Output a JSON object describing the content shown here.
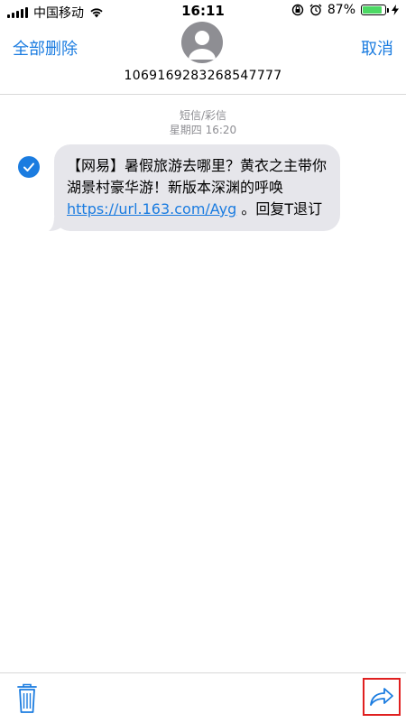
{
  "status_bar": {
    "carrier": "中国移动",
    "time": "16:11",
    "battery_percent": "87%",
    "battery_level": 0.87,
    "icons": [
      "signal-icon",
      "wifi-icon",
      "rotation-lock-icon",
      "alarm-icon",
      "battery-icon",
      "charging-icon"
    ]
  },
  "header": {
    "delete_all_label": "全部删除",
    "cancel_label": "取消",
    "contact_number": "1069169283268547777",
    "avatar_icon": "person-icon"
  },
  "message_meta": {
    "type_label": "短信/彩信",
    "timestamp": "星期四 16:20"
  },
  "message": {
    "selected": true,
    "text_before_link": "【网易】暑假旅游去哪里？黄衣之主带你湖景村豪华游！新版本深渊的呼唤 ",
    "link": "https://url.163.com/Ayg",
    "text_after_link": " 。回复T退订"
  },
  "toolbar": {
    "delete_icon": "trash-icon",
    "forward_icon": "forward-arrow-icon"
  },
  "colors": {
    "accent": "#1b7ce0",
    "bubble": "#e6e6eb",
    "highlight_box": "#e02020",
    "battery": "#4cd964"
  }
}
